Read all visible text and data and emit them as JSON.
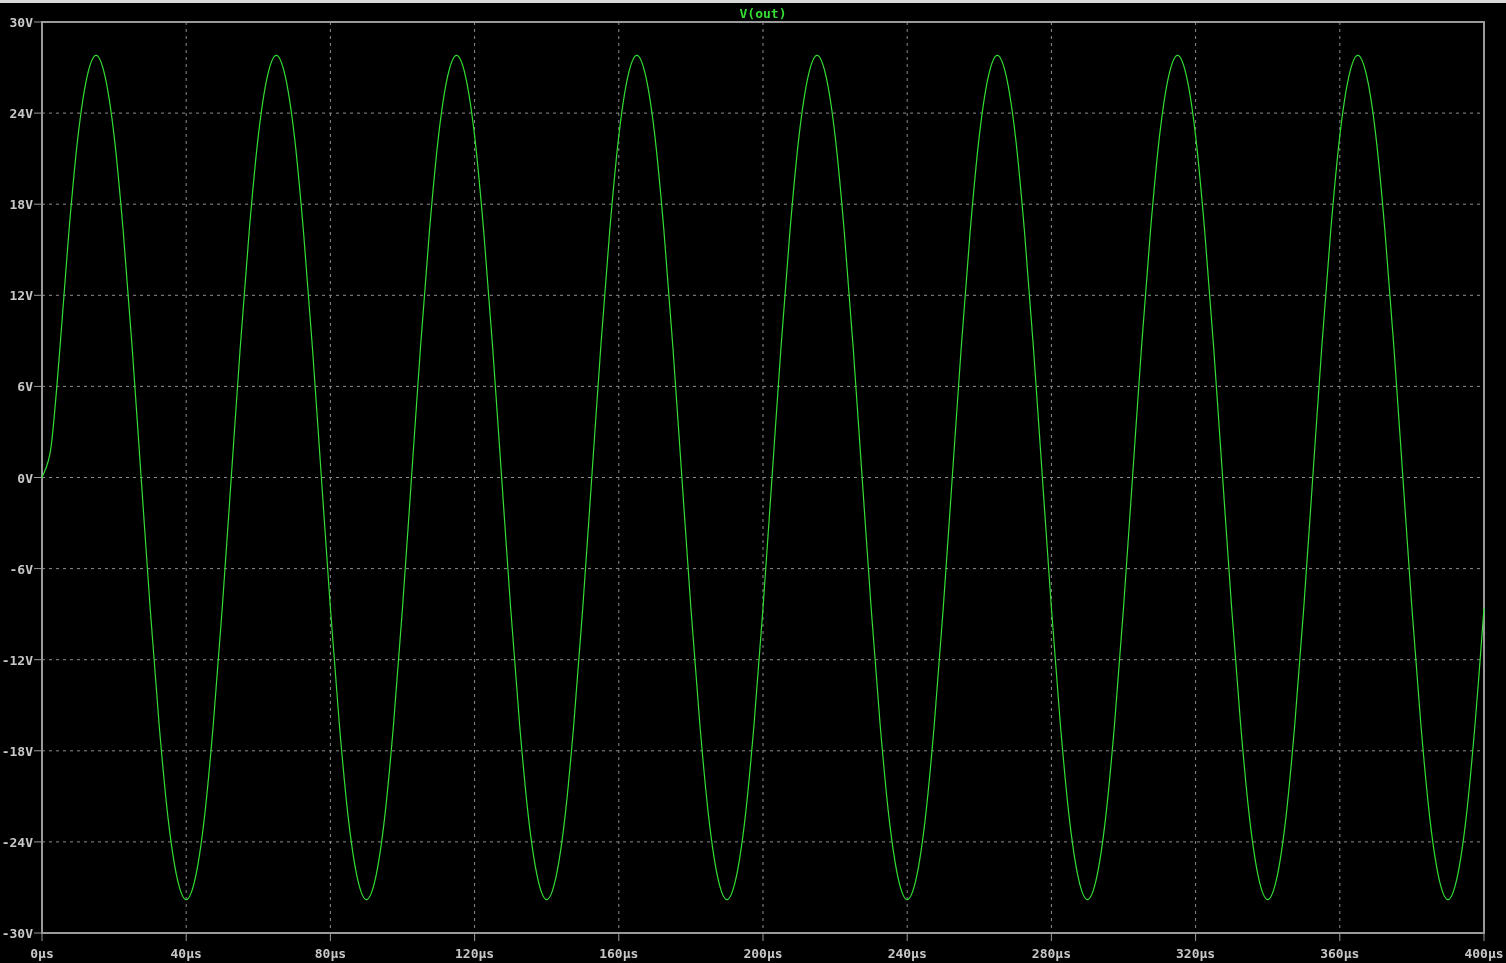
{
  "plot": {
    "chart_data": {
      "type": "line",
      "grid": true,
      "x": [
        0,
        2.5,
        5,
        7.5,
        10,
        12.5,
        15,
        17.5,
        20,
        22.5,
        25,
        27.5,
        30,
        32.5,
        35,
        37.5,
        40,
        42.5,
        45,
        47.5,
        50,
        52.5,
        55,
        57.5,
        60,
        62.5,
        65,
        67.5,
        70,
        72.5,
        75,
        77.5,
        80,
        82.5,
        85,
        87.5,
        90,
        92.5,
        95,
        97.5,
        100,
        102.5,
        105,
        107.5,
        110,
        112.5,
        115,
        117.5,
        120,
        122.5,
        125,
        127.5,
        130,
        132.5,
        135,
        137.5,
        140,
        142.5,
        145,
        147.5,
        150,
        152.5,
        155,
        157.5,
        160,
        162.5,
        165,
        167.5,
        170,
        172.5,
        175,
        177.5,
        180,
        182.5,
        185,
        187.5,
        190,
        192.5,
        195,
        197.5,
        200,
        202.5,
        205,
        207.5,
        210,
        212.5,
        215,
        217.5,
        220,
        222.5,
        225,
        227.5,
        230,
        232.5,
        235,
        237.5,
        240,
        242.5,
        245,
        247.5,
        250,
        252.5,
        255,
        257.5,
        260,
        262.5,
        265,
        267.5,
        270,
        272.5,
        275,
        277.5,
        280,
        282.5,
        285,
        287.5,
        290,
        292.5,
        295,
        297.5,
        300,
        302.5,
        305,
        307.5,
        310,
        312.5,
        315,
        317.5,
        320,
        322.5,
        325,
        327.5,
        330,
        332.5,
        335,
        337.5,
        340,
        342.5,
        345,
        347.5,
        350,
        352.5,
        355,
        357.5,
        360,
        362.5,
        365,
        367.5,
        370,
        372.5,
        375,
        377.5,
        380,
        382.5,
        385,
        387.5,
        390,
        392.5,
        395,
        397.5,
        400
      ],
      "series": [
        {
          "name": "V(out)",
          "color": "#33dd33",
          "values": [
            0,
            2,
            8.6,
            16.3,
            22.5,
            26.4,
            27.8,
            26.4,
            22.5,
            16.3,
            8.6,
            0,
            -8.6,
            -16.3,
            -22.5,
            -26.4,
            -27.8,
            -26.4,
            -22.5,
            -16.3,
            -8.6,
            0,
            8.6,
            16.3,
            22.5,
            26.4,
            27.8,
            26.4,
            22.5,
            16.3,
            8.6,
            0,
            -8.6,
            -16.3,
            -22.5,
            -26.4,
            -27.8,
            -26.4,
            -22.5,
            -16.3,
            -8.6,
            0,
            8.6,
            16.3,
            22.5,
            26.4,
            27.8,
            26.4,
            22.5,
            16.3,
            8.6,
            0,
            -8.6,
            -16.3,
            -22.5,
            -26.4,
            -27.8,
            -26.4,
            -22.5,
            -16.3,
            -8.6,
            0,
            8.6,
            16.3,
            22.5,
            26.4,
            27.8,
            26.4,
            22.5,
            16.3,
            8.6,
            0,
            -8.6,
            -16.3,
            -22.5,
            -26.4,
            -27.8,
            -26.4,
            -22.5,
            -16.3,
            -8.6,
            0,
            8.6,
            16.3,
            22.5,
            26.4,
            27.8,
            26.4,
            22.5,
            16.3,
            8.6,
            0,
            -8.6,
            -16.3,
            -22.5,
            -26.4,
            -27.8,
            -26.4,
            -22.5,
            -16.3,
            -8.6,
            0,
            8.6,
            16.3,
            22.5,
            26.4,
            27.8,
            26.4,
            22.5,
            16.3,
            8.6,
            0,
            -8.6,
            -16.3,
            -22.5,
            -26.4,
            -27.8,
            -26.4,
            -22.5,
            -16.3,
            -8.6,
            0,
            8.6,
            16.3,
            22.5,
            26.4,
            27.8,
            26.4,
            22.5,
            16.3,
            8.6,
            0,
            -8.6,
            -16.3,
            -22.5,
            -26.4,
            -27.8,
            -26.4,
            -22.5,
            -16.3,
            -8.6,
            0,
            8.6,
            16.3,
            22.5,
            26.4,
            27.8,
            26.4,
            22.5,
            16.3,
            8.6,
            0,
            -8.6,
            -16.3,
            -22.5,
            -26.4,
            -27.8,
            -26.4,
            -22.5,
            -16.3,
            -8.6
          ]
        }
      ],
      "xlim": [
        0,
        400
      ],
      "ylim": [
        -30,
        30
      ],
      "xticks": [
        {
          "value": 0,
          "label": "0µs"
        },
        {
          "value": 40,
          "label": "40µs"
        },
        {
          "value": 80,
          "label": "80µs"
        },
        {
          "value": 120,
          "label": "120µs"
        },
        {
          "value": 160,
          "label": "160µs"
        },
        {
          "value": 200,
          "label": "200µs"
        },
        {
          "value": 240,
          "label": "240µs"
        },
        {
          "value": 280,
          "label": "280µs"
        },
        {
          "value": 320,
          "label": "320µs"
        },
        {
          "value": 360,
          "label": "360µs"
        },
        {
          "value": 400,
          "label": "400µs"
        }
      ],
      "yticks": [
        {
          "value": 30,
          "label": "30V"
        },
        {
          "value": 24,
          "label": "24V"
        },
        {
          "value": 18,
          "label": "18V"
        },
        {
          "value": 12,
          "label": "12V"
        },
        {
          "value": 6,
          "label": "6V"
        },
        {
          "value": 0,
          "label": "0V"
        },
        {
          "value": -6,
          "label": "-6V"
        },
        {
          "value": -12,
          "label": "-12V"
        },
        {
          "value": -18,
          "label": "-18V"
        },
        {
          "value": -24,
          "label": "-24V"
        },
        {
          "value": -30,
          "label": "-30V"
        }
      ]
    }
  }
}
